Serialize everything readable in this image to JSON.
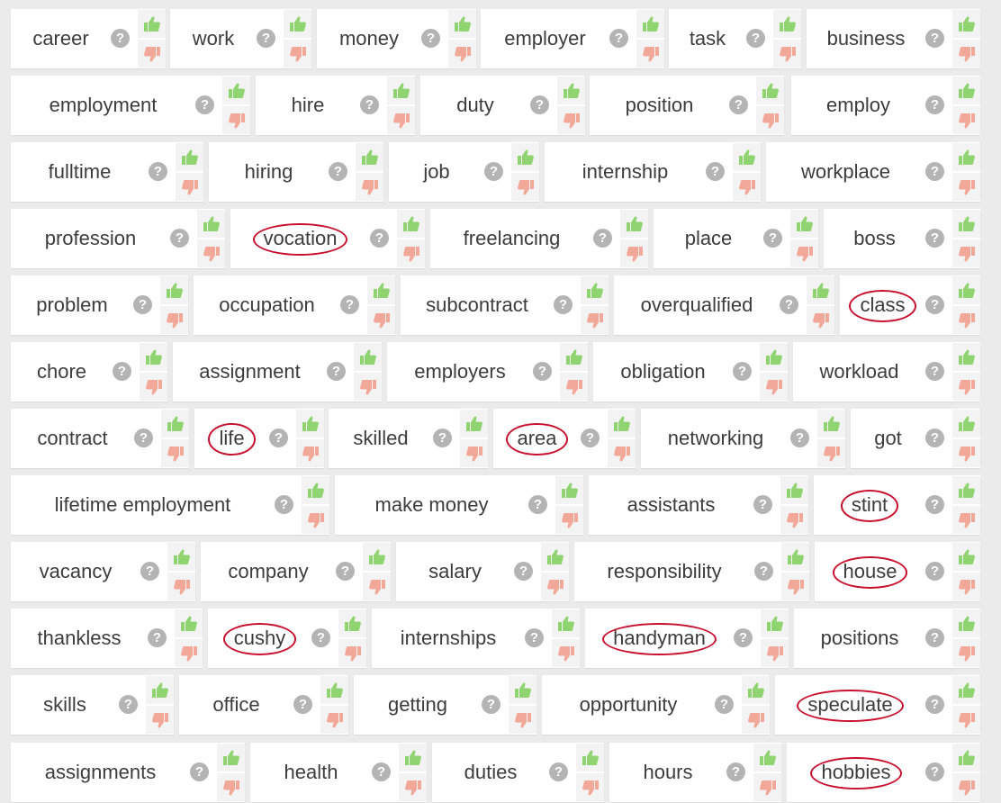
{
  "colors": {
    "thumb_up": "#8fd470",
    "thumb_down": "#f2a899",
    "help_bg": "#b4b4b4",
    "circle_annotation": "#c8102e",
    "text": "#3c3c3c"
  },
  "help_glyph": "?",
  "icons": {
    "up": "thumbs-up-icon",
    "down": "thumbs-down-icon",
    "help": "question-icon"
  },
  "rows": [
    [
      {
        "label": "career",
        "circled": false
      },
      {
        "label": "work",
        "circled": false
      },
      {
        "label": "money",
        "circled": false
      },
      {
        "label": "employer",
        "circled": false
      },
      {
        "label": "task",
        "circled": false
      },
      {
        "label": "business",
        "circled": false
      }
    ],
    [
      {
        "label": "employment",
        "circled": false
      },
      {
        "label": "hire",
        "circled": false
      },
      {
        "label": "duty",
        "circled": false
      },
      {
        "label": "position",
        "circled": false
      },
      {
        "label": "employ",
        "circled": false
      }
    ],
    [
      {
        "label": "fulltime",
        "circled": false
      },
      {
        "label": "hiring",
        "circled": false
      },
      {
        "label": "job",
        "circled": false
      },
      {
        "label": "internship",
        "circled": false
      },
      {
        "label": "workplace",
        "circled": false
      }
    ],
    [
      {
        "label": "profession",
        "circled": false
      },
      {
        "label": "vocation",
        "circled": true
      },
      {
        "label": "freelancing",
        "circled": false
      },
      {
        "label": "place",
        "circled": false
      },
      {
        "label": "boss",
        "circled": false
      }
    ],
    [
      {
        "label": "problem",
        "circled": false
      },
      {
        "label": "occupation",
        "circled": false
      },
      {
        "label": "subcontract",
        "circled": false
      },
      {
        "label": "overqualified",
        "circled": false
      },
      {
        "label": "class",
        "circled": true
      }
    ],
    [
      {
        "label": "chore",
        "circled": false
      },
      {
        "label": "assignment",
        "circled": false
      },
      {
        "label": "employers",
        "circled": false
      },
      {
        "label": "obligation",
        "circled": false
      },
      {
        "label": "workload",
        "circled": false
      }
    ],
    [
      {
        "label": "contract",
        "circled": false
      },
      {
        "label": "life",
        "circled": true
      },
      {
        "label": "skilled",
        "circled": false
      },
      {
        "label": "area",
        "circled": true
      },
      {
        "label": "networking",
        "circled": false
      },
      {
        "label": "got",
        "circled": false
      }
    ],
    [
      {
        "label": "lifetime employment",
        "circled": false
      },
      {
        "label": "make money",
        "circled": false
      },
      {
        "label": "assistants",
        "circled": false
      },
      {
        "label": "stint",
        "circled": true
      }
    ],
    [
      {
        "label": "vacancy",
        "circled": false
      },
      {
        "label": "company",
        "circled": false
      },
      {
        "label": "salary",
        "circled": false
      },
      {
        "label": "responsibility",
        "circled": false
      },
      {
        "label": "house",
        "circled": true
      }
    ],
    [
      {
        "label": "thankless",
        "circled": false
      },
      {
        "label": "cushy",
        "circled": true
      },
      {
        "label": "internships",
        "circled": false
      },
      {
        "label": "handyman",
        "circled": true
      },
      {
        "label": "positions",
        "circled": false
      }
    ],
    [
      {
        "label": "skills",
        "circled": false
      },
      {
        "label": "office",
        "circled": false
      },
      {
        "label": "getting",
        "circled": false
      },
      {
        "label": "opportunity",
        "circled": false
      },
      {
        "label": "speculate",
        "circled": true
      }
    ],
    [
      {
        "label": "assignments",
        "circled": false
      },
      {
        "label": "health",
        "circled": false
      },
      {
        "label": "duties",
        "circled": false
      },
      {
        "label": "hours",
        "circled": false
      },
      {
        "label": "hobbies",
        "circled": true
      }
    ]
  ]
}
